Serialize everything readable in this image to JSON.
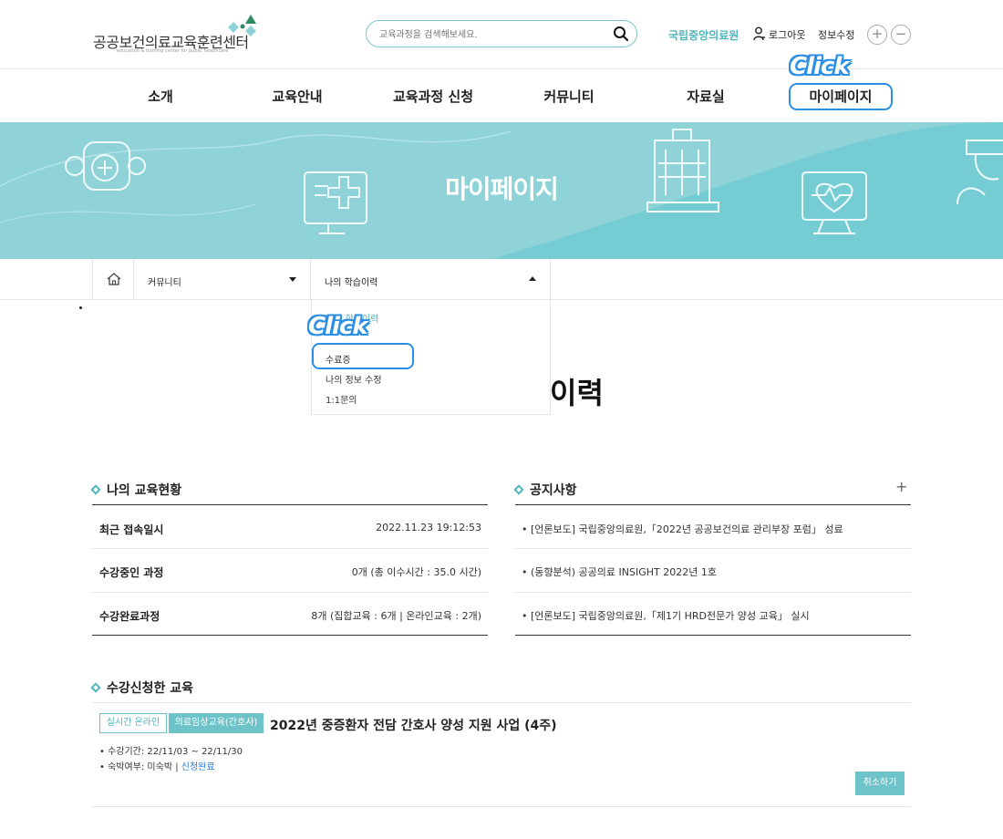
{
  "header": {
    "logo_title": "공공보건의료교육훈련센터",
    "logo_sub": "education & training center for public healthcare",
    "search_placeholder": "교육과정을 검색해보세요.",
    "org_link": "국립중앙의료원",
    "logout": "로그아웃",
    "edit_info": "정보수정",
    "zoom_in": "+",
    "zoom_out": "−",
    "accent_color": "#4fb5bd"
  },
  "gnb": {
    "items": [
      "소개",
      "교육안내",
      "교육과정 신청",
      "커뮤니티",
      "자료실",
      "마이페이지"
    ]
  },
  "annotations": {
    "click1": "Click",
    "click2": "Click"
  },
  "banner": {
    "title": "마이페이지"
  },
  "location": {
    "dropdown1": "커뮤니티",
    "dropdown2": "나의 학습이력",
    "menu": [
      "나의 학습이력",
      "수료증",
      "나의 정보 수정",
      "1:1문의"
    ]
  },
  "page": {
    "title_fragment": "이력"
  },
  "status": {
    "title": "나의 교육현황",
    "rows": [
      {
        "label": "최근 접속일시",
        "value": "2022.11.23 19:12:53"
      },
      {
        "label": "수강중인 과정",
        "value": "0개 (총 이수시간 : 35.0 시간)"
      },
      {
        "label": "수강완료과정",
        "value": "8개 (집합교육 : 6개 | 온라인교육 : 2개)"
      }
    ]
  },
  "notices": {
    "title": "공지사항",
    "more": "+",
    "items": [
      "• [언론보도] 국립중앙의료원,「2022년 공공보건의료 관리부장 포럼」 성료",
      "• (동향분석) 공공의료 INSIGHT 2022년 1호",
      "• [언론보도] 국립중앙의료원,「제1기 HRD전문가 양성 교육」 실시"
    ]
  },
  "applied": {
    "title": "수강신청한 교육",
    "tag1": "실시간 온라인",
    "tag2": "의료임상교육(간호사)",
    "course_title": "2022년 중증환자 전담 간호사 양성 지원 사업 (4주)",
    "period": "• 수강기간: 22/11/03 ~ 22/11/30",
    "lodging_prefix": "• 숙박여부: 미숙박 | ",
    "lodging_status": "신청완료",
    "cancel": "취소하기"
  }
}
